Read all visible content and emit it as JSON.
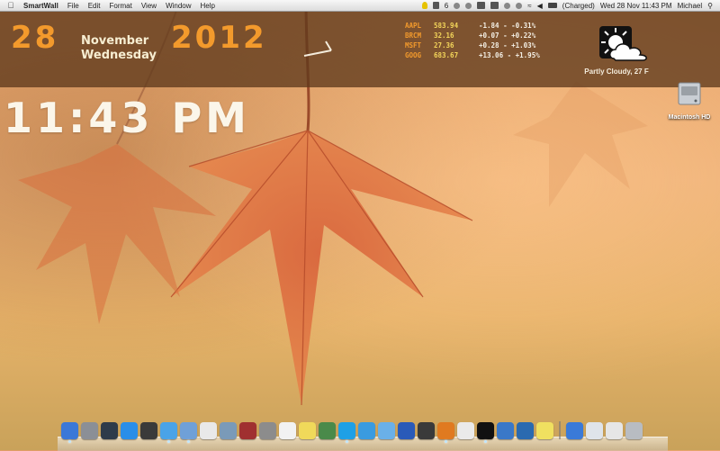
{
  "menubar": {
    "app_name": "SmartWall",
    "menus": [
      "File",
      "Edit",
      "Format",
      "View",
      "Window",
      "Help"
    ],
    "status": {
      "notification_count": "6",
      "battery": "(Charged)",
      "datetime": "Wed 28 Nov  11:43 PM",
      "user": "Michael"
    }
  },
  "widget": {
    "day": "28",
    "month": "November",
    "weekday": "Wednesday",
    "year": "2012",
    "time": "11:43 PM",
    "stocks": [
      {
        "symbol": "AAPL",
        "price": "583.94",
        "change": "-1.84 - -0.31%"
      },
      {
        "symbol": "BRCM",
        "price": "32.16",
        "change": "+0.07 - +0.22%"
      },
      {
        "symbol": "MSFT",
        "price": "27.36",
        "change": "+0.28 - +1.03%"
      },
      {
        "symbol": "GOOG",
        "price": "683.67",
        "change": "+13.06 - +1.95%"
      }
    ],
    "weather": "Partly Cloudy, 27 F"
  },
  "desktop": {
    "hd_label": "Macintosh HD"
  },
  "colors": {
    "accent_orange": "#f39a2c",
    "band": "#5f3a1c",
    "price_yellow": "#f3d55a"
  },
  "dock": {
    "items": [
      {
        "name": "finder",
        "color": "#3b78d8",
        "running": true
      },
      {
        "name": "launchpad",
        "color": "#8b8f96",
        "running": false
      },
      {
        "name": "mission-control",
        "color": "#2e3b4a",
        "running": false
      },
      {
        "name": "app-store",
        "color": "#2a8ee8",
        "running": false
      },
      {
        "name": "dashboard",
        "color": "#3a3a3a",
        "running": false
      },
      {
        "name": "safari",
        "color": "#4aa3e8",
        "running": true
      },
      {
        "name": "mail",
        "color": "#6fa0d8",
        "running": true
      },
      {
        "name": "calendar",
        "color": "#e9e9e9",
        "running": false
      },
      {
        "name": "iphoto",
        "color": "#7a9ab8",
        "running": false
      },
      {
        "name": "photo-booth",
        "color": "#a03030",
        "running": false
      },
      {
        "name": "system-preferences",
        "color": "#8c8c8c",
        "running": false
      },
      {
        "name": "textedit",
        "color": "#f2f2f2",
        "running": false
      },
      {
        "name": "stickies",
        "color": "#f0d95a",
        "running": false
      },
      {
        "name": "activity-monitor",
        "color": "#4a8a4a",
        "running": false
      },
      {
        "name": "skype",
        "color": "#1ea0e6",
        "running": true
      },
      {
        "name": "messages",
        "color": "#3a9be0",
        "running": false
      },
      {
        "name": "itunes",
        "color": "#6ab0e8",
        "running": false
      },
      {
        "name": "word",
        "color": "#2a5ab8",
        "running": false
      },
      {
        "name": "aperture",
        "color": "#3a3a3a",
        "running": false
      },
      {
        "name": "firefox",
        "color": "#e07a20",
        "running": true
      },
      {
        "name": "cleaner",
        "color": "#eaeaea",
        "running": false
      },
      {
        "name": "terminal",
        "color": "#111111",
        "running": true
      },
      {
        "name": "xcode",
        "color": "#3a78c8",
        "running": false
      },
      {
        "name": "network-utility",
        "color": "#2a6ab0",
        "running": false
      },
      {
        "name": "tips",
        "color": "#f0e060",
        "running": false
      },
      {
        "name": "bluetooth",
        "color": "#3a7ad8",
        "running": false
      },
      {
        "name": "applications-folder",
        "color": "#dfe4ea",
        "running": false
      },
      {
        "name": "documents-folder",
        "color": "#e6e6e6",
        "running": false
      },
      {
        "name": "trash",
        "color": "#b8bcc2",
        "running": false
      }
    ]
  }
}
